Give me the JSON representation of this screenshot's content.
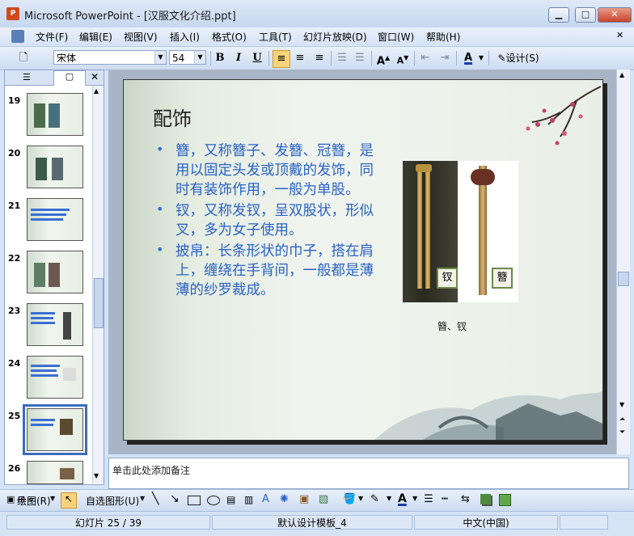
{
  "window": {
    "title": "Microsoft PowerPoint - [汉服文化介绍.ppt]",
    "app_icon": "powerpoint-icon"
  },
  "menubar": {
    "items": [
      "文件(F)",
      "编辑(E)",
      "视图(V)",
      "插入(I)",
      "格式(O)",
      "工具(T)",
      "幻灯片放映(D)",
      "窗口(W)",
      "帮助(H)"
    ]
  },
  "toolbar": {
    "font_name": "宋体",
    "font_size": "54",
    "bold": "B",
    "italic": "I",
    "underline": "U",
    "design_label": "设计(S)"
  },
  "thumbnails": {
    "numbers": [
      "19",
      "20",
      "21",
      "22",
      "23",
      "24",
      "25",
      "26"
    ],
    "selected": "25"
  },
  "slide": {
    "title": "配饰",
    "bullets": [
      "簪，又称簪子、发簪、冠簪，是用以固定头发或顶戴的发饰，同时有装饰作用，一般为单股。",
      "钗，又称发钗，呈双股状，形似叉，多为女子使用。",
      "披帛：长条形状的巾子，搭在肩上，缠绕在手背间，一般都是薄薄的纱罗裁成。"
    ],
    "picture_labels": {
      "left": "钗",
      "right": "簪"
    },
    "caption": "簪、钗"
  },
  "notes": {
    "placeholder": "单击此处添加备注"
  },
  "drawbar": {
    "draw_label": "绘图(R)",
    "autoshape_label": "自选图形(U)"
  },
  "statusbar": {
    "slide_info": "幻灯片 25 / 39",
    "template": "默认设计模板_4",
    "language": "中文(中国)"
  },
  "colors": {
    "bullet_text": "#2a62c8",
    "selection": "#3a6bbd"
  }
}
